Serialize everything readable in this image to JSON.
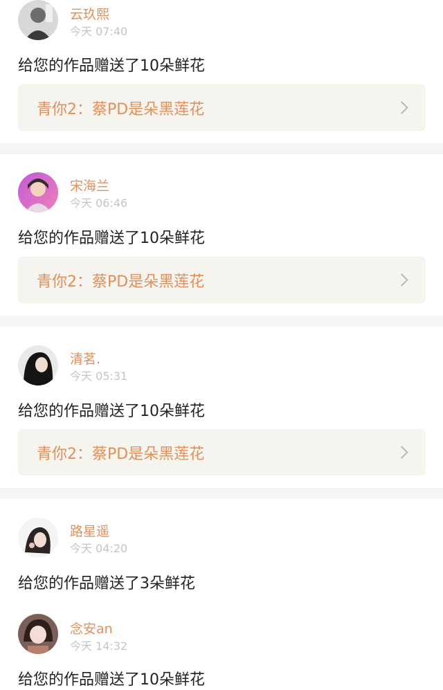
{
  "notifications": [
    {
      "user": "云玖熙",
      "time": "今天 07:40",
      "message": "给您的作品赠送了10朵鲜花",
      "work_title": "青你2：蔡PD是朵黑莲花",
      "avatar_icon": "avatar-icon"
    },
    {
      "user": "宋海兰",
      "time": "今天 06:46",
      "message": "给您的作品赠送了10朵鲜花",
      "work_title": "青你2：蔡PD是朵黑莲花",
      "avatar_icon": "avatar-icon"
    },
    {
      "user": "清茗.",
      "time": "今天 05:31",
      "message": "给您的作品赠送了10朵鲜花",
      "work_title": "青你2：蔡PD是朵黑莲花",
      "avatar_icon": "avatar-icon"
    },
    {
      "user": "路星遥",
      "time": "今天 04:20",
      "message": "给您的作品赠送了3朵鲜花",
      "avatar_icon": "avatar-icon"
    },
    {
      "user": "念安an",
      "time": "今天 14:32",
      "message": "给您的作品赠送了10朵鲜花",
      "avatar_icon": "avatar-icon"
    }
  ],
  "colors": {
    "username": "#e0905a",
    "work_title": "#e38f57",
    "time": "#c4c4c4",
    "card_bg": "#f5f4ee",
    "separator": "#f5f5f5"
  }
}
